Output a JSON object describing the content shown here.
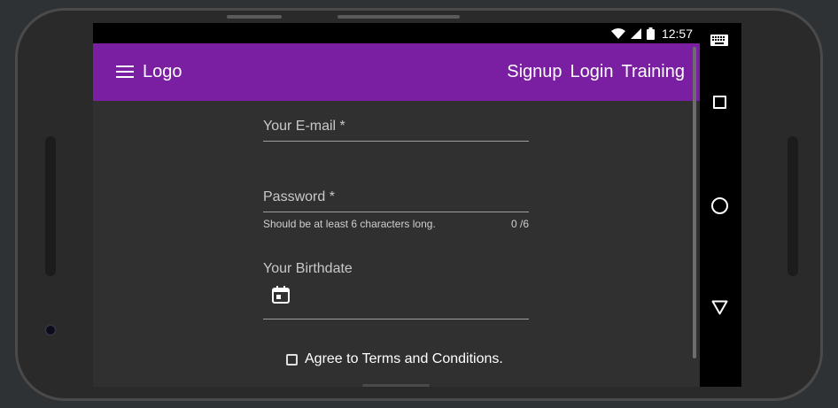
{
  "status_bar": {
    "time": "12:57",
    "icons": [
      "wifi-icon",
      "signal-icon",
      "battery-icon"
    ]
  },
  "toolbar": {
    "logo": "Logo",
    "nav": [
      "Signup",
      "Login",
      "Training"
    ]
  },
  "form": {
    "email": {
      "label": "Your E-mail *"
    },
    "password": {
      "label": "Password *",
      "hint": "Should be at least 6 characters long.",
      "counter": "0 /6"
    },
    "birthdate": {
      "label": "Your Birthdate",
      "icon": "calendar-icon"
    },
    "terms": {
      "label": "Agree to Terms and Conditions."
    }
  },
  "navbar": {
    "icons": [
      "keyboard-icon",
      "recent-apps-icon",
      "home-icon",
      "back-icon"
    ]
  },
  "colors": {
    "primary": "#7b1fa2",
    "background": "#303030",
    "text": "#ffffff",
    "hint": "#c9c9c9"
  }
}
